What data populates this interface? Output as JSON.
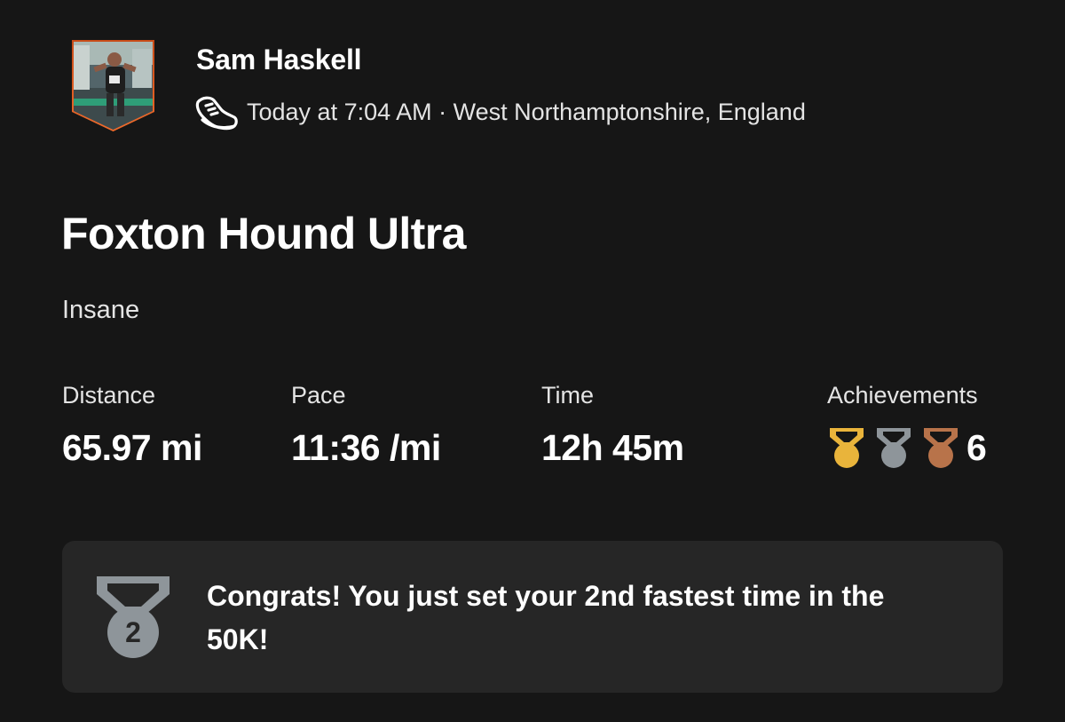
{
  "athlete": {
    "name": "Sam Haskell"
  },
  "activity": {
    "meta": "Today at 7:04 AM · West Northamptonshire, England",
    "title": "Foxton Hound Ultra",
    "description": "Insane",
    "sport_icon": "running-shoe-icon"
  },
  "stats": {
    "distance": {
      "label": "Distance",
      "value": "65.97 mi"
    },
    "pace": {
      "label": "Pace",
      "value": "11:36 /mi"
    },
    "time": {
      "label": "Time",
      "value": "12h 45m"
    },
    "achievements": {
      "label": "Achievements",
      "count": "6",
      "medals": [
        "gold-medal-icon",
        "silver-medal-icon",
        "bronze-medal-icon"
      ]
    }
  },
  "congrats": {
    "text": "Congrats! You just set your 2nd fastest time in the 50K!",
    "medal_rank": "2",
    "medal_icon": "second-place-medal-icon"
  },
  "colors": {
    "background": "#161616",
    "card": "#262626",
    "gold": "#E9B43B",
    "silver": "#8E959A",
    "bronze": "#B8734A",
    "avatar_border": "#E05A1E"
  }
}
